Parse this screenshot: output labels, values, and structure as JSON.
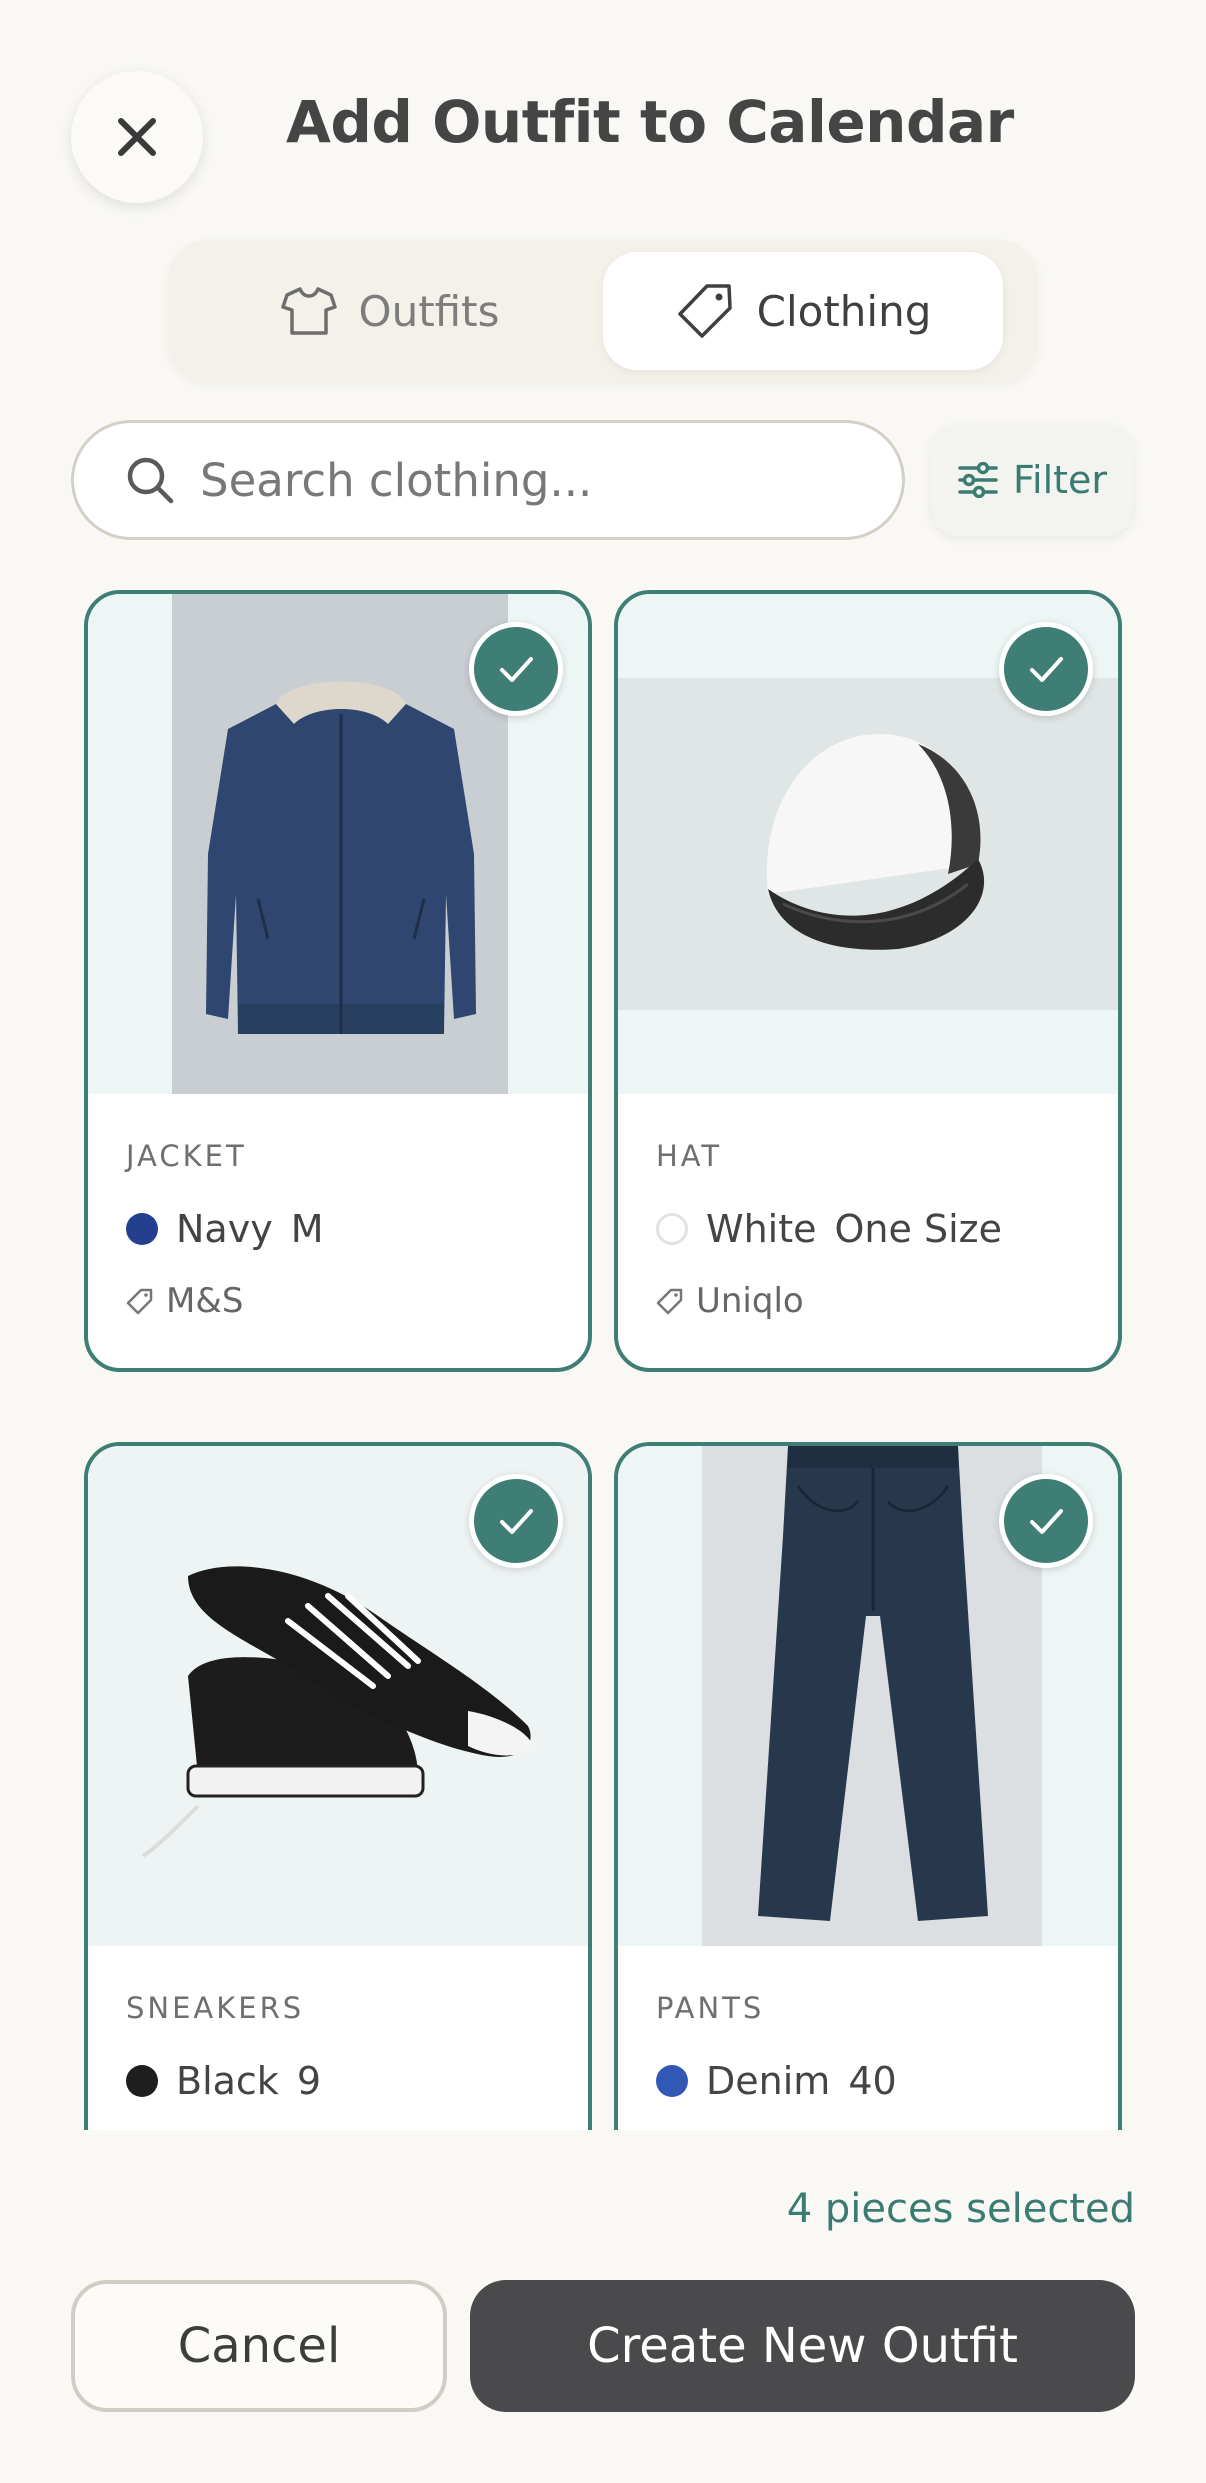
{
  "header": {
    "title": "Add Outfit to Calendar"
  },
  "tabs": [
    {
      "label": "Outfits",
      "icon": "shirt-icon",
      "active": false
    },
    {
      "label": "Clothing",
      "icon": "tag-icon",
      "active": true
    }
  ],
  "search": {
    "placeholder": "Search clothing...",
    "value": ""
  },
  "filter": {
    "label": "Filter",
    "icon": "sliders-icon"
  },
  "items": [
    {
      "category": "JACKET",
      "color_name": "Navy",
      "color_hex": "#253f8f",
      "size": "M",
      "brand": "M&S",
      "selected": true
    },
    {
      "category": "HAT",
      "color_name": "White",
      "color_hex": "#ffffff",
      "size": "One Size",
      "brand": "Uniqlo",
      "selected": true
    },
    {
      "category": "SNEAKERS",
      "color_name": "Black",
      "color_hex": "#1e1e1e",
      "size": "9",
      "brand": "",
      "selected": true
    },
    {
      "category": "PANTS",
      "color_name": "Denim",
      "color_hex": "#3158b5",
      "size": "40",
      "brand": "",
      "selected": true
    }
  ],
  "footer": {
    "selected_text": "4 pieces selected",
    "cancel_label": "Cancel",
    "create_label": "Create New Outfit"
  },
  "colors": {
    "accent": "#3f7e74",
    "background": "#f9f8f4",
    "primary_button": "#4a4a4c"
  }
}
